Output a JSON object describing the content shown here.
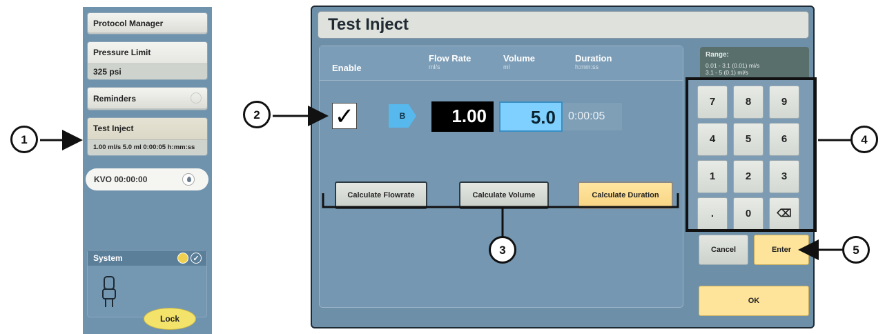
{
  "sidebar": {
    "protocol_manager": "Protocol Manager",
    "pressure_limit_label": "Pressure Limit",
    "pressure_limit_value": "325 psi",
    "reminders": "Reminders",
    "test_inject_label": "Test Inject",
    "test_inject_value": "1.00 ml/s 5.0 ml 0:00:05 h:mm:ss",
    "kvo": "KVO 00:00:00",
    "system": "System",
    "lock": "Lock"
  },
  "panel": {
    "title": "Test Inject",
    "enable_label": "Enable",
    "enable_checked": "✓",
    "columns": [
      {
        "label": "Flow Rate",
        "unit": "ml/s"
      },
      {
        "label": "Volume",
        "unit": "ml"
      },
      {
        "label": "Duration",
        "unit": "h:mm:ss"
      }
    ],
    "syringe": "B",
    "flow_rate": "1.00",
    "volume": "5.0",
    "duration": "0:00:05",
    "buttons": {
      "calc_flowrate": "Calculate Flowrate",
      "calc_volume": "Calculate Volume",
      "calc_duration": "Calculate Duration"
    },
    "range": {
      "title": "Range:",
      "line1": "0.01 - 3.1 (0.01) ml/s",
      "line2": "3.1 - 5 (0.1) ml/s"
    },
    "keypad": [
      "7",
      "8",
      "9",
      "4",
      "5",
      "6",
      "1",
      "2",
      "3",
      ".",
      "0",
      "⌫"
    ],
    "cancel": "Cancel",
    "enter": "Enter",
    "ok": "OK"
  },
  "callouts": [
    "1",
    "2",
    "3",
    "4",
    "5"
  ]
}
